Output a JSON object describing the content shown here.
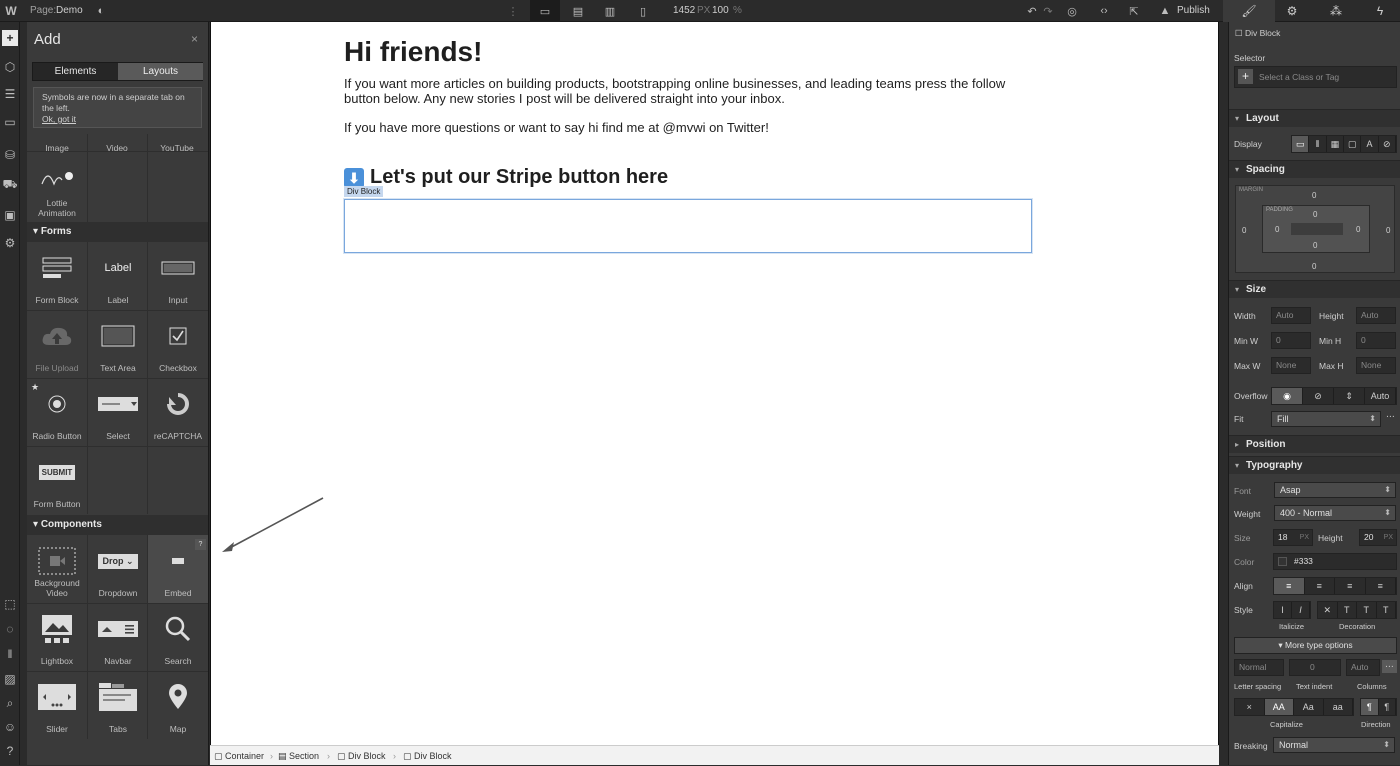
{
  "topbar": {
    "page_label": "Page:",
    "page_name": "Demo",
    "width": "1452",
    "width_unit": "PX",
    "zoom": "100",
    "zoom_unit": "%",
    "publish": "Publish"
  },
  "add_panel": {
    "title": "Add",
    "close": "×",
    "tabs": [
      "Elements",
      "Layouts"
    ],
    "notice": [
      "Symbols are now in a separate tab on",
      "the left.",
      "Ok, got it"
    ],
    "media_labels": [
      "Image",
      "Video",
      "YouTube"
    ],
    "lottie": "Lottie Animation",
    "forms_header": "Forms",
    "forms": [
      {
        "label": "Form Block",
        "icon": "form-block-icon"
      },
      {
        "label": "Label",
        "icon": "label-icon",
        "icon_text": "Label"
      },
      {
        "label": "Input",
        "icon": "input-icon"
      },
      {
        "label": "File Upload",
        "icon": "cloud-upload-icon"
      },
      {
        "label": "Text Area",
        "icon": "textarea-icon"
      },
      {
        "label": "Checkbox",
        "icon": "checkbox-icon"
      },
      {
        "label": "Radio Button",
        "icon": "radio-icon"
      },
      {
        "label": "Select",
        "icon": "select-icon"
      },
      {
        "label": "reCAPTCHA",
        "icon": "recaptcha-icon"
      },
      {
        "label": "Form Button",
        "icon": "submit-icon",
        "icon_text": "SUBMIT"
      }
    ],
    "components_header": "Components",
    "components": [
      {
        "label": "Background Video",
        "icon": "background-video-icon"
      },
      {
        "label": "Dropdown",
        "icon": "dropdown-icon",
        "icon_text": "Drop"
      },
      {
        "label": "Embed",
        "icon": "embed-icon",
        "icon_text": "</>"
      },
      {
        "label": "Lightbox",
        "icon": "lightbox-icon"
      },
      {
        "label": "Navbar",
        "icon": "navbar-icon"
      },
      {
        "label": "Search",
        "icon": "search-icon"
      },
      {
        "label": "Slider",
        "icon": "slider-icon"
      },
      {
        "label": "Tabs",
        "icon": "tabs-icon"
      },
      {
        "label": "Map",
        "icon": "map-pin-icon"
      }
    ],
    "help": "?"
  },
  "canvas": {
    "heading": "Hi friends!",
    "para1": "If you want more articles on building products, bootstrapping online businesses, and leading teams press the follow button below. Any new stories I post will be delivered straight into your inbox.",
    "para2": "If you have more questions or want to say hi find me at @mvwi on Twitter!",
    "heading2": "Let's put our Stripe button here",
    "selected_tag": "Div Block"
  },
  "breadcrumbs": [
    "Container",
    "Section",
    "Div Block",
    "Div Block"
  ],
  "right_panel": {
    "element": "Div Block",
    "selector_label": "Selector",
    "selector_placeholder": "Select a Class or Tag",
    "layout": "Layout",
    "display": "Display",
    "spacing": "Spacing",
    "margin": "MARGIN",
    "padding": "PADDING",
    "margin_vals": [
      "0",
      "0",
      "0",
      "0"
    ],
    "padding_vals": [
      "0",
      "0",
      "0",
      "0"
    ],
    "size": "Size",
    "width": "Width",
    "height": "Height",
    "auto": "Auto",
    "min_w": "Min W",
    "min_h": "Min H",
    "max_w": "Max W",
    "max_h": "Max H",
    "zero": "0",
    "px": "PX",
    "none": "None",
    "overflow": "Overflow",
    "overflow_auto": "Auto",
    "fit": "Fit",
    "fit_value": "Fill",
    "position": "Position",
    "typography": "Typography",
    "font": "Font",
    "font_value": "Asap",
    "weight": "Weight",
    "weight_value": "400 - Normal",
    "size_label": "Size",
    "size_value": "18",
    "lh_label": "Height",
    "lh_value": "20",
    "color": "Color",
    "color_value": "#333",
    "align": "Align",
    "style": "Style",
    "italicize": "Italicize",
    "decoration": "Decoration",
    "more_type": "More type options",
    "normal": "Normal",
    "letter_spacing": "Letter spacing",
    "text_indent": "Text indent",
    "columns": "Columns",
    "capitalize": "Capitalize",
    "direction": "Direction",
    "breaking": "Breaking",
    "breaking_value": "Normal",
    "cap_opts": [
      "×",
      "AA",
      "Aa",
      "aa"
    ]
  },
  "colors": {
    "canvas": "#ffffff",
    "panel": "#3a3a3a",
    "selection": "#7aa7dd"
  }
}
